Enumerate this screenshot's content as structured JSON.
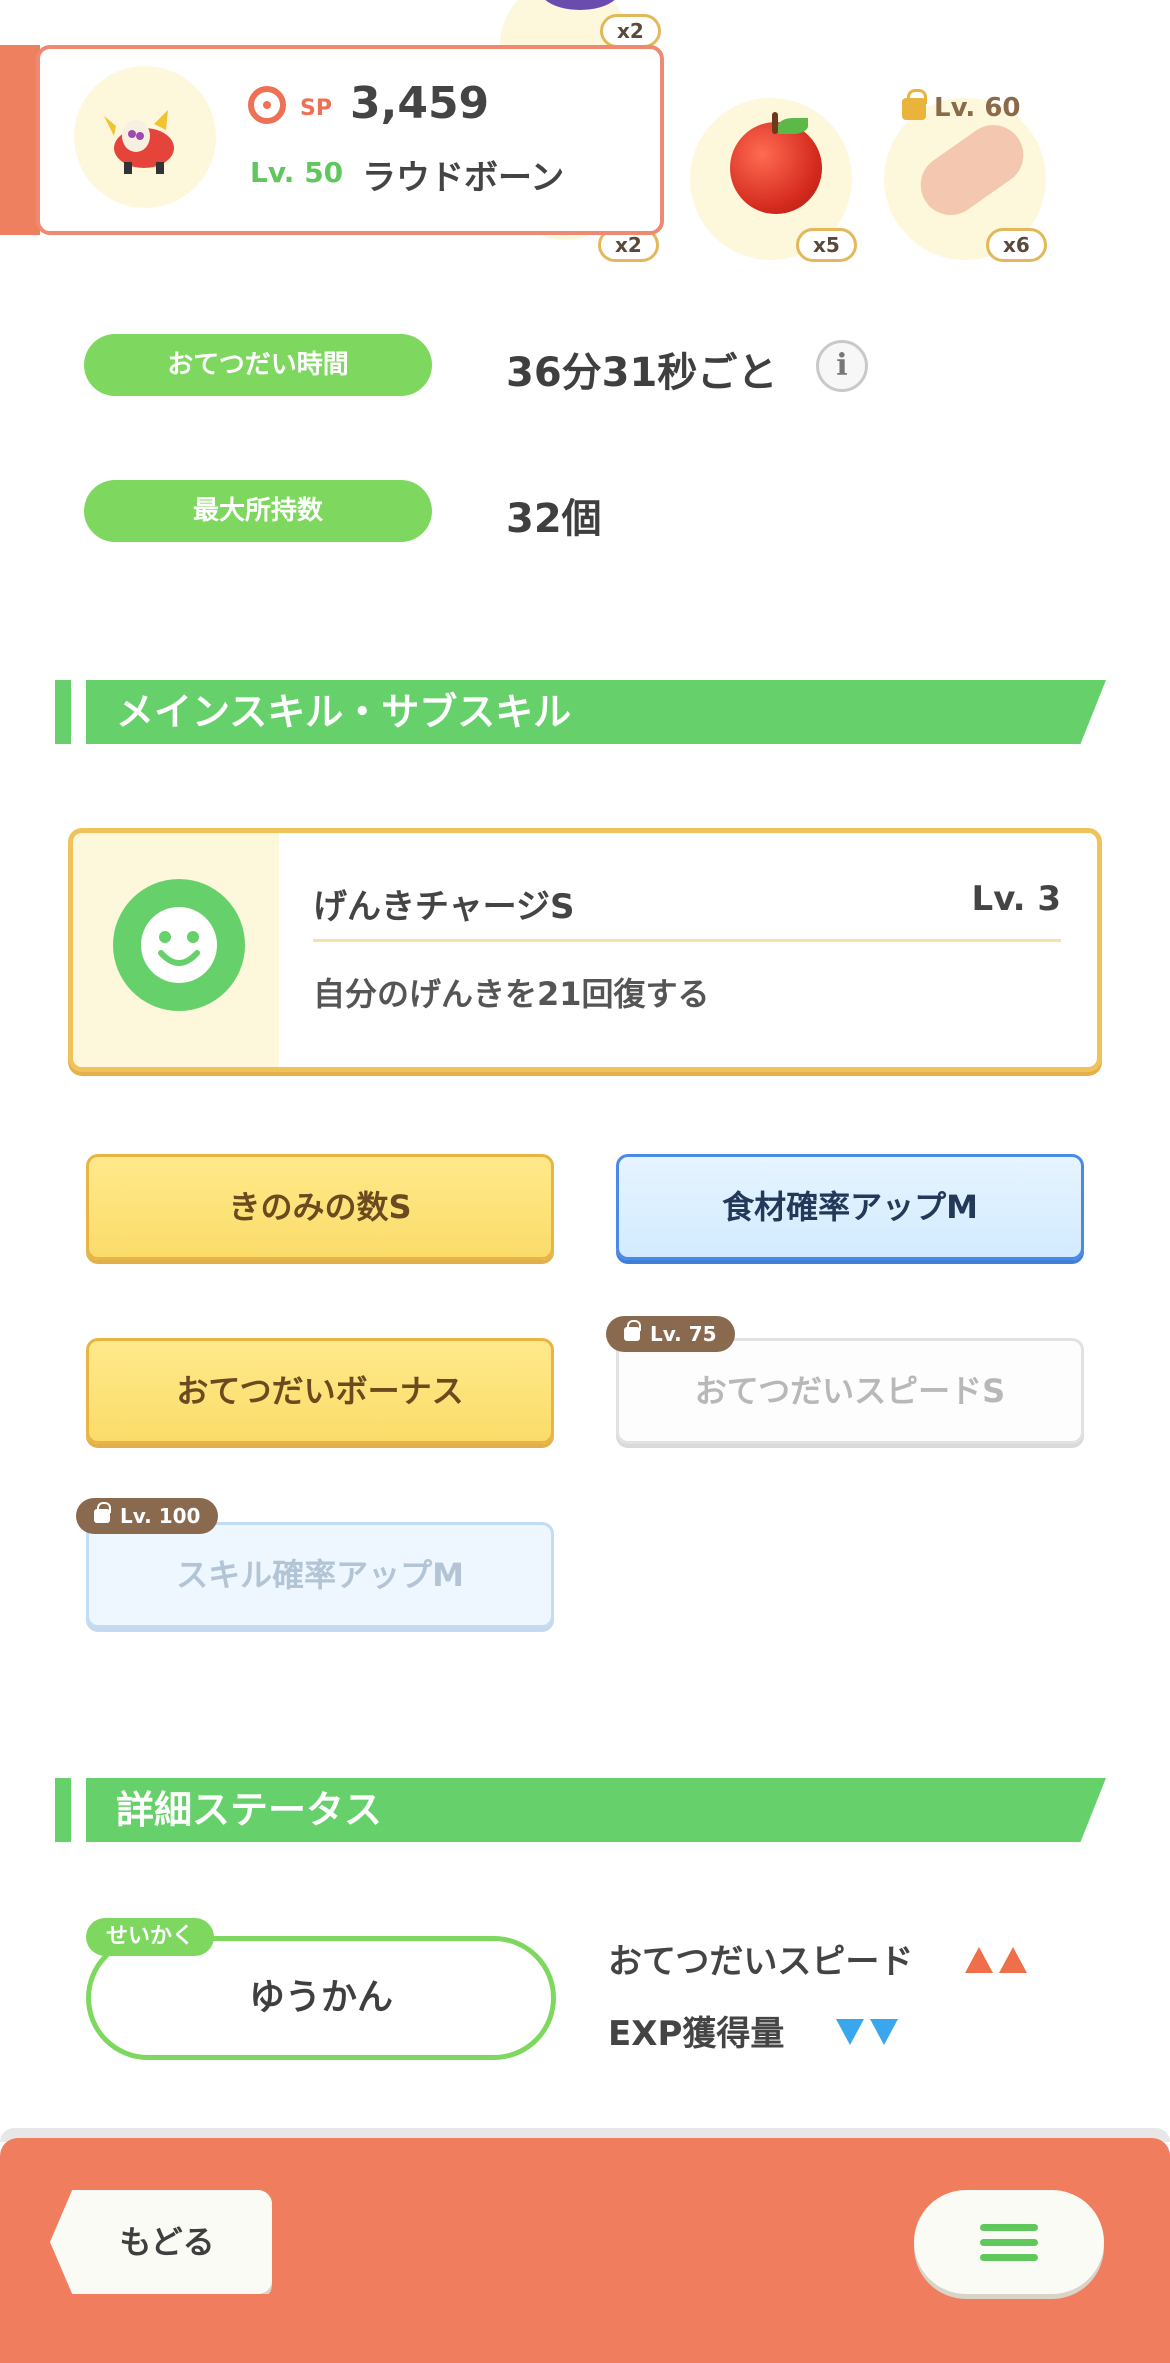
{
  "header": {
    "sp_label": "SP",
    "sp_value": "3,459",
    "level_label": "Lv. 50",
    "pokemon_name": "ラウドボーン"
  },
  "ingredients": {
    "slot1_count": "x2",
    "slot1_top_count": "x2",
    "slot2_count": "x5",
    "slot3_count": "x6",
    "slot3_lock_level": "Lv. 60"
  },
  "info": {
    "help_time_label": "おてつだい時間",
    "help_time_value": "36分31秒ごと",
    "max_carry_label": "最大所持数",
    "max_carry_value": "32個",
    "info_icon_glyph": "i"
  },
  "skills_section": {
    "title": "メインスキル・サブスキル"
  },
  "main_skill": {
    "name": "げんきチャージS",
    "level": "Lv. 3",
    "description": "自分のげんきを21回復する",
    "icon": "smiley-face-icon"
  },
  "sub_skills": [
    {
      "label": "きのみの数S",
      "style": "gold",
      "locked": false
    },
    {
      "label": "食材確率アップM",
      "style": "blue",
      "locked": false
    },
    {
      "label": "おてつだいボーナス",
      "style": "gold",
      "locked": false
    },
    {
      "label": "おてつだいスピードS",
      "style": "white",
      "locked": true,
      "lock_level": "Lv. 75"
    },
    {
      "label": "スキル確率アップM",
      "style": "blue",
      "locked": true,
      "lock_level": "Lv. 100"
    }
  ],
  "status_section": {
    "title": "詳細ステータス"
  },
  "nature": {
    "tag": "せいかく",
    "value": "ゆうかん",
    "up_stat": "おてつだいスピード",
    "down_stat": "EXP獲得量"
  },
  "footer": {
    "back_label": "もどる",
    "menu_icon": "hamburger-menu-icon"
  },
  "colors": {
    "accent_green": "#66d16a",
    "accent_orange": "#f07e5e",
    "up_arrow": "#ee6f4a",
    "down_arrow": "#3aa6ee"
  }
}
